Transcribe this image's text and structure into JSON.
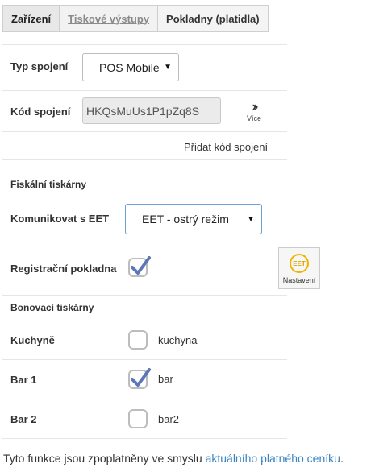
{
  "tabs": [
    {
      "label": "Zařízení"
    },
    {
      "label": "Tiskové výstupy"
    },
    {
      "label": "Pokladny (platidla)"
    }
  ],
  "connection": {
    "type_label": "Typ spojení",
    "type_value": "POS Mobile",
    "code_label": "Kód spojení",
    "code_value": "HKQsMuUs1P1pZq8S",
    "more_label": "Více",
    "add_code_label": "Přidat kód spojení"
  },
  "fiscal": {
    "section_title": "Fiskální tiskárny",
    "eet_label": "Komunikovat s EET",
    "eet_value": "EET - ostrý režim",
    "register_label": "Registrační pokladna",
    "register_checked": true,
    "eet_logo_text": "EET",
    "settings_label": "Nastavení"
  },
  "receipt_printers": {
    "section_title": "Bonovací tiskárny",
    "items": [
      {
        "label": "Kuchyně",
        "value": "kuchyna",
        "checked": false
      },
      {
        "label": "Bar 1",
        "value": "bar",
        "checked": true
      },
      {
        "label": "Bar 2",
        "value": "bar2",
        "checked": false
      }
    ]
  },
  "footer": {
    "text": "Tyto funkce jsou zpoplatněny ve smyslu ",
    "link": "aktuálního platného ceníku",
    "end": "."
  },
  "colors": {
    "accent": "#3a84c0",
    "check": "#5b78b6",
    "eet": "#f0b400"
  }
}
